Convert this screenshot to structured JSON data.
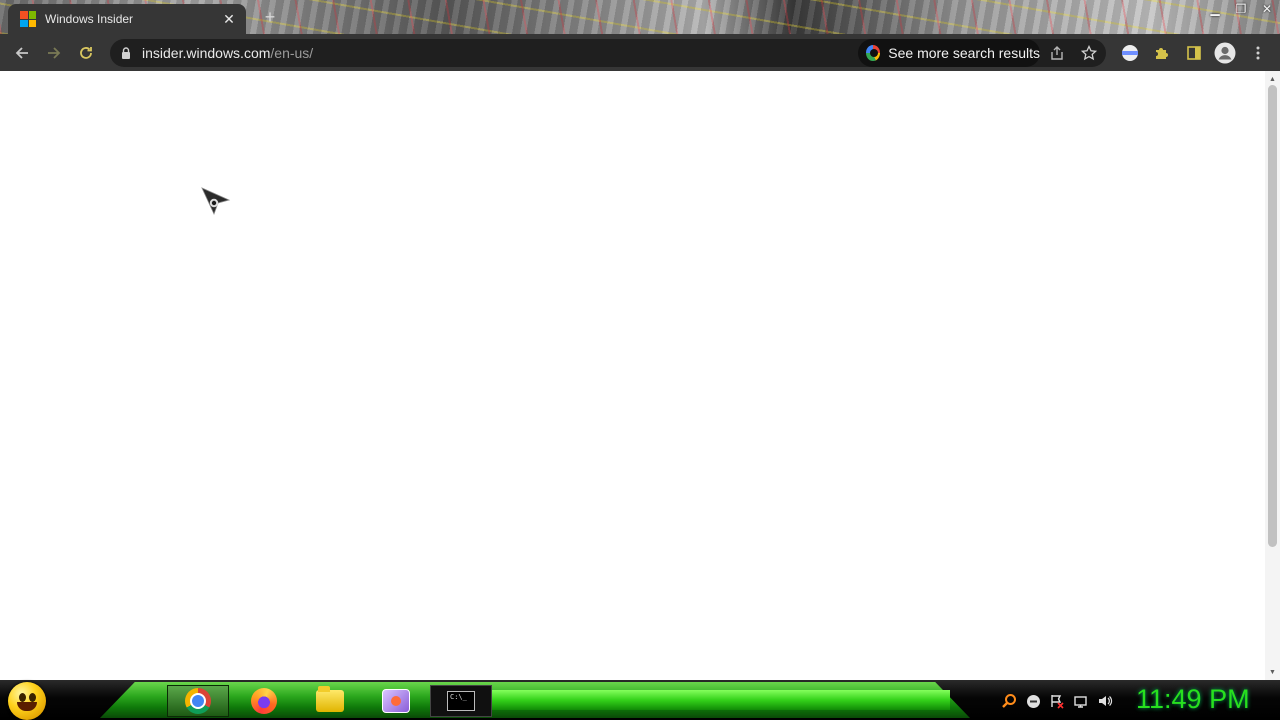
{
  "browser": {
    "tab": {
      "title": "Windows Insider",
      "favicon": "microsoft-logo-icon",
      "close_icon": "close-icon"
    },
    "new_tab_icon": "plus-icon",
    "window_controls": [
      "minimize-icon",
      "restore-icon",
      "close-icon"
    ],
    "toolbar": {
      "back_icon": "arrow-left-icon",
      "forward_icon": "arrow-right-icon",
      "reload_icon": "reload-icon",
      "lock_icon": "lock-icon",
      "url_host": "insider.windows.com",
      "url_path": "/en-us/",
      "search_chip_label": "See more search results",
      "share_icon": "share-icon",
      "bookmark_icon": "star-icon",
      "extension_icons": [
        "profile-extension-icon",
        "puzzle-icon",
        "side-panel-icon",
        "account-icon",
        "more-icon"
      ]
    }
  },
  "page": {
    "scrollbar": {
      "up_icon": "triangle-up-icon",
      "down_icon": "triangle-down-icon"
    }
  },
  "taskbar": {
    "start_button": "smiley-start-icon",
    "apps": [
      {
        "name": "chrome",
        "icon": "chrome-icon",
        "active": true
      },
      {
        "name": "firefox",
        "icon": "firefox-icon",
        "active": false
      },
      {
        "name": "file-explorer",
        "icon": "folder-icon",
        "active": false
      },
      {
        "name": "paint",
        "icon": "paint-icon",
        "active": false
      },
      {
        "name": "command-prompt",
        "icon": "cmd-icon",
        "active": false,
        "label": "C:\\_"
      }
    ],
    "tray_icons": [
      "search-icon",
      "minus-circle-icon",
      "flag-icon",
      "network-icon",
      "volume-icon"
    ],
    "clock": "11:49 PM"
  },
  "colors": {
    "toolbar_bg": "#363636",
    "omnibox_bg": "#1f1f1f",
    "clock_green": "#28e01e",
    "taskbar_green": "#2ba71d"
  }
}
